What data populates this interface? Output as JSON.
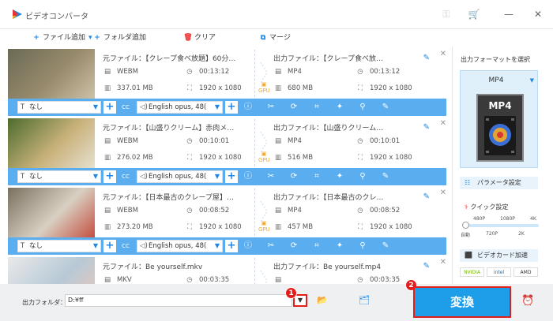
{
  "app": {
    "title": "ビデオコンバータ",
    "window_buttons": [
      "key-icon",
      "cart-icon",
      "minimize-icon",
      "close-icon"
    ]
  },
  "toolbar": {
    "add_file": "ファイル追加",
    "add_folder": "フォルダ追加",
    "clear": "クリア",
    "merge": "マージ"
  },
  "items": [
    {
      "src_name": "元ファイル：【クレープ食べ放題】60分…",
      "src_format": "WEBM",
      "src_duration": "00:13:12",
      "src_size": "337.01 MB",
      "src_resolution": "1920 x 1080",
      "out_name": "出力ファイル：【クレープ食べ放…",
      "out_format": "MP4",
      "out_duration": "00:13:12",
      "out_size": "680 MB",
      "out_resolution": "1920 x 1080",
      "subtitle": "なし",
      "audio": "English opus, 48(",
      "thumb_colors": [
        "#6a6a55",
        "#9a8c6e",
        "#cfc3a8"
      ]
    },
    {
      "src_name": "元ファイル：【山盛りクリーム】赤肉メ…",
      "src_format": "WEBM",
      "src_duration": "00:10:01",
      "src_size": "276.02 MB",
      "src_resolution": "1920 x 1080",
      "out_name": "出力ファイル：【山盛りクリーム…",
      "out_format": "MP4",
      "out_duration": "00:10:01",
      "out_size": "516 MB",
      "out_resolution": "1920 x 1080",
      "subtitle": "なし",
      "audio": "English opus, 48(",
      "thumb_colors": [
        "#4d6b2e",
        "#c9b27a",
        "#e7e2d3"
      ]
    },
    {
      "src_name": "元ファイル：【日本最古のクレープ屋】…",
      "src_format": "WEBM",
      "src_duration": "00:08:52",
      "src_size": "273.20 MB",
      "src_resolution": "1920 x 1080",
      "out_name": "出力ファイル：【日本最古のクレ…",
      "out_format": "MP4",
      "out_duration": "00:08:52",
      "out_size": "457 MB",
      "out_resolution": "1920 x 1080",
      "subtitle": "なし",
      "audio": "English opus, 48(",
      "thumb_colors": [
        "#7a7060",
        "#d8d0c2",
        "#c44a3a"
      ]
    },
    {
      "src_name": "元ファイル：Be yourself.mkv",
      "src_format": "MKV",
      "src_duration": "00:03:35",
      "src_size": "",
      "src_resolution": "",
      "out_name": "出力ファイル：Be yourself.mp4",
      "out_format": "",
      "out_duration": "00:03:35",
      "out_size": "",
      "out_resolution": "",
      "subtitle": "",
      "audio": "",
      "thumb_colors": [
        "#e9e9e9",
        "#b7c9d6",
        "#f0c8b8"
      ]
    }
  ],
  "right_panel": {
    "title": "出力フォーマットを選択",
    "format": "MP4",
    "format_image_text": "MP4",
    "param": "パラメータ設定",
    "quick": "クイック設定",
    "slider_top": [
      "480P",
      "1080P",
      "4K"
    ],
    "slider_bottom": [
      "自動",
      "720P",
      "2K"
    ],
    "slider_level": 0.0,
    "gpu": "ビデオカード加速",
    "vendors": [
      "NVIDIA",
      "intel",
      "AMD"
    ]
  },
  "bottom": {
    "output_label": "出力フォルダ：",
    "output_path": "D:¥ff",
    "convert": "変換",
    "badge1": "1",
    "badge2": "2"
  },
  "colors": {
    "accent": "#1e9ee8",
    "bar": "#5aadee",
    "highlight": "#e41d1d"
  }
}
